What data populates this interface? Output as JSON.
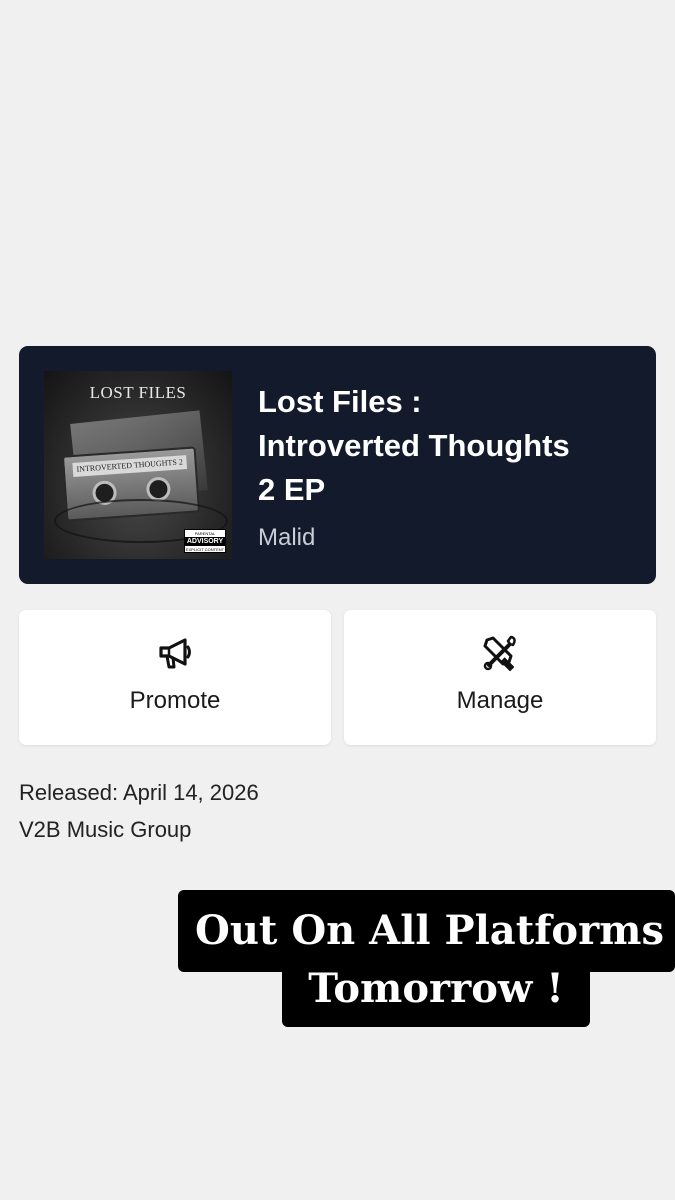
{
  "release": {
    "title_lines": [
      "Lost Files :",
      "Introverted Thoughts",
      "2 EP"
    ],
    "artist": "Malid",
    "cover": {
      "title": "LOST FILES",
      "cassette_label": "INTROVERTED THOUGHTS 2",
      "advisory_top": "PARENTAL",
      "advisory_main": "ADVISORY",
      "advisory_bottom": "EXPLICIT CONTENT"
    }
  },
  "actions": [
    {
      "label": "Promote",
      "icon": "megaphone-icon"
    },
    {
      "label": "Manage",
      "icon": "tools-icon"
    }
  ],
  "meta": {
    "released": "Released: April 14, 2026",
    "label": "V2B Music Group"
  },
  "promo": {
    "line1": "Out On All Platforms",
    "line2": "Tomorrow !"
  },
  "colors": {
    "background": "#f0f0f0",
    "card": "#121a2b",
    "promo_box": "#000000"
  }
}
